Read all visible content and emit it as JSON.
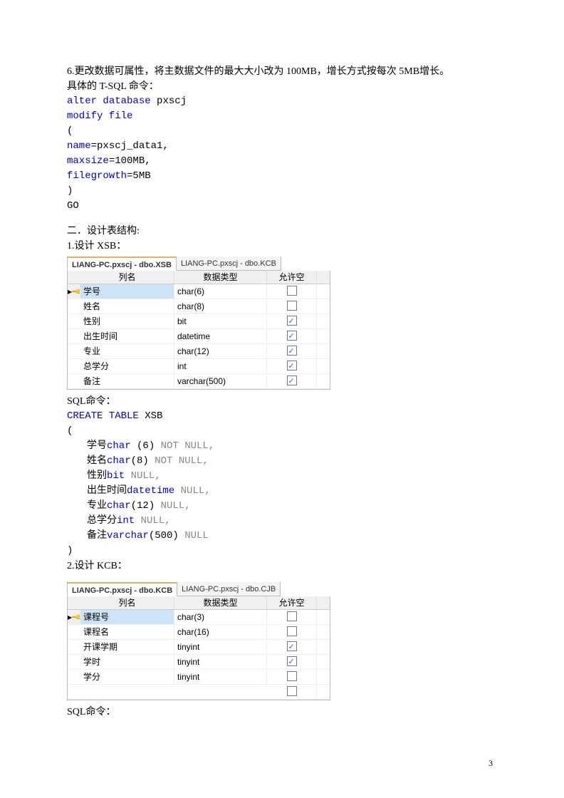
{
  "intro": "6.更改数据可属性，将主数据文件的最大大小改为 100MB，增长方式按每次 5MB增长。",
  "tsql_label": "具体的 T-SQL 命令：",
  "sql1": {
    "l1a": "alter",
    "l1b": " database",
    "l1c": " pxscj",
    "l2": "modify file",
    "l3": "(",
    "l4a": "name",
    "l4b": "=pxscj_data1,",
    "l5a": "maxsize",
    "l5b": "=100MB,",
    "l6a": "filegrowth",
    "l6b": "=5MB",
    "l7": ")",
    "l8": "GO"
  },
  "section2": "二．设计表结构:",
  "xsb_label": "1.设计 XSB：",
  "xsb_tabs": {
    "active": "LIANG-PC.pxscj - dbo.XSB",
    "inactive": "LIANG-PC.pxscj - dbo.KCB"
  },
  "hdr": {
    "col": "列名",
    "type": "数据类型",
    "null": "允许空"
  },
  "xsb_rows": [
    {
      "pk": true,
      "name": "学号",
      "type": "char(6)",
      "null": false
    },
    {
      "pk": false,
      "name": "姓名",
      "type": "char(8)",
      "null": false
    },
    {
      "pk": false,
      "name": "性别",
      "type": "bit",
      "null": true
    },
    {
      "pk": false,
      "name": "出生时间",
      "type": "datetime",
      "null": true
    },
    {
      "pk": false,
      "name": "专业",
      "type": "char(12)",
      "null": true
    },
    {
      "pk": false,
      "name": "总学分",
      "type": "int",
      "null": true
    },
    {
      "pk": false,
      "name": "备注",
      "type": "varchar(500)",
      "null": true
    }
  ],
  "sqlcmd_label": "SQL命令：",
  "xsb_sql": {
    "l1a": "CREATE",
    "l1b": " TABLE",
    "l1c": " XSB",
    "l2": "(",
    "rows": [
      {
        "name": "学号",
        "type": "char",
        "args": " (6)",
        "null": " NOT NULL,"
      },
      {
        "name": "姓名",
        "type": "char",
        "args": "(8)",
        "null": " NOT NULL,"
      },
      {
        "name": "性别",
        "type": "bit",
        "args": "",
        "null": " NULL,"
      },
      {
        "name": "出生时间",
        "type": "datetime",
        "args": "",
        "null": " NULL,"
      },
      {
        "name": "专业",
        "type": "char",
        "args": "(12)",
        "null": " NULL,"
      },
      {
        "name": "总学分",
        "type": "int",
        "args": "",
        "null": " NULL,"
      },
      {
        "name": "备注",
        "type": "varchar",
        "args": "(500)",
        "null": " NULL"
      }
    ],
    "lend": ")"
  },
  "kcb_label": "2.设计 KCB：",
  "kcb_tabs": {
    "active": "LIANG-PC.pxscj - dbo.KCB",
    "inactive": "LIANG-PC.pxscj - dbo.CJB"
  },
  "kcb_rows": [
    {
      "pk": true,
      "name": "课程号",
      "type": "char(3)",
      "null": false
    },
    {
      "pk": false,
      "name": "课程名",
      "type": "char(16)",
      "null": false
    },
    {
      "pk": false,
      "name": "开课学期",
      "type": "tinyint",
      "null": true
    },
    {
      "pk": false,
      "name": "学时",
      "type": "tinyint",
      "null": true
    },
    {
      "pk": false,
      "name": "学分",
      "type": "tinyint",
      "null": false
    }
  ],
  "page_num": "3"
}
